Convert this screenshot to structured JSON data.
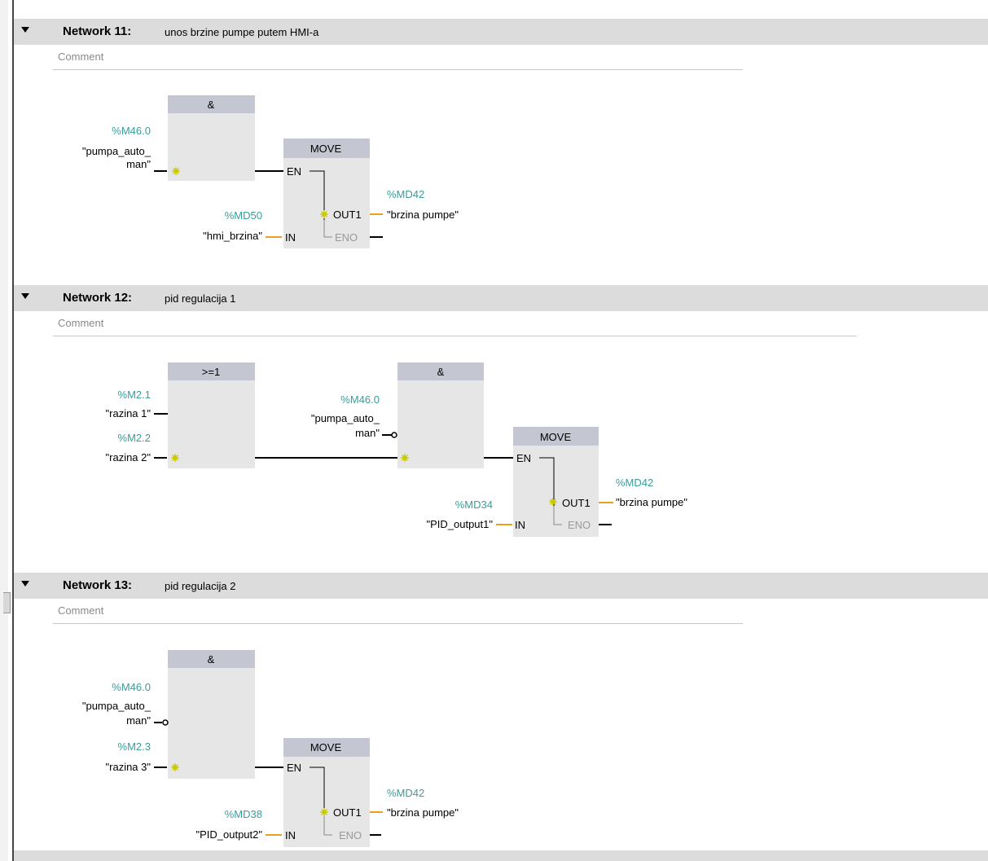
{
  "common": {
    "comment_placeholder": "Comment",
    "and_label": "&",
    "or_label": ">=1",
    "move_label": "MOVE",
    "pin_en": "EN",
    "pin_in": "IN",
    "pin_out1": "OUT1",
    "pin_eno": "ENO"
  },
  "colors": {
    "header_bg": "#dcdcdc",
    "box_fill": "#e6e6e6",
    "box_header": "#c4c7d2",
    "address_teal": "#3a9c9c",
    "wire_orange": "#e8a020"
  },
  "networks": [
    {
      "title": "Network 11:",
      "description": "unos brzine pumpe putem HMI-a",
      "and_in1": {
        "addr": "%M46.0",
        "tag_line1": "\"pumpa_auto_",
        "tag_line2": "man\""
      },
      "move": {
        "in_addr": "%MD50",
        "in_tag": "\"hmi_brzina\"",
        "out_addr": "%MD42",
        "out_tag": "\"brzina pumpe\""
      }
    },
    {
      "title": "Network 12:",
      "description": "pid regulacija 1",
      "or_in1": {
        "addr": "%M2.1",
        "tag": "\"razina 1\""
      },
      "or_in2": {
        "addr": "%M2.2",
        "tag": "\"razina 2\""
      },
      "and_in1": {
        "addr": "%M46.0",
        "tag_line1": "\"pumpa_auto_",
        "tag_line2": "man\""
      },
      "move": {
        "in_addr": "%MD34",
        "in_tag": "\"PID_output1\"",
        "out_addr": "%MD42",
        "out_tag": "\"brzina pumpe\""
      }
    },
    {
      "title": "Network 13:",
      "description": "pid regulacija 2",
      "and_in1": {
        "addr": "%M46.0",
        "tag_line1": "\"pumpa_auto_",
        "tag_line2": "man\""
      },
      "and_in2": {
        "addr": "%M2.3",
        "tag": "\"razina 3\""
      },
      "move": {
        "in_addr": "%MD38",
        "in_tag": "\"PID_output2\"",
        "out_addr": "%MD42",
        "out_tag": "\"brzina pumpe\""
      }
    }
  ]
}
